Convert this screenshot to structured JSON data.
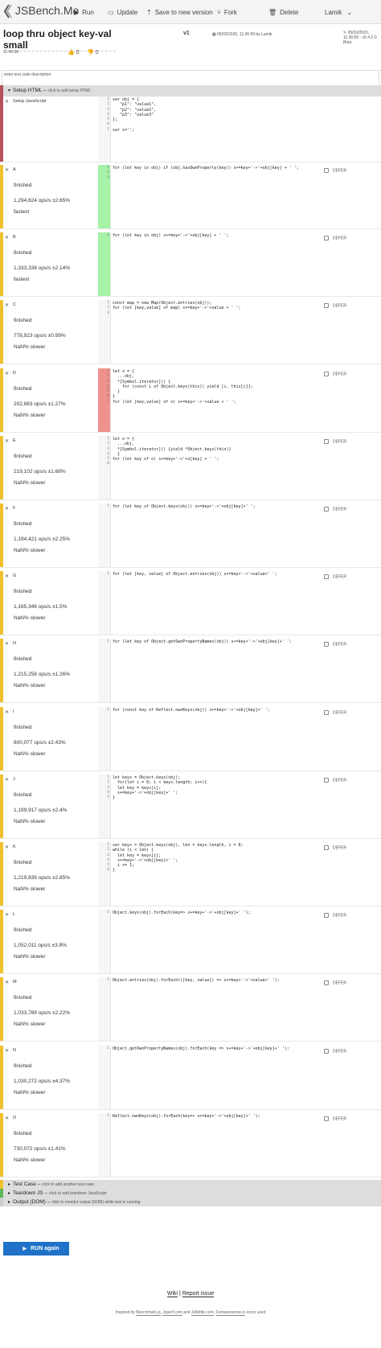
{
  "app": {
    "name": "JSBench.Me"
  },
  "toolbar": {
    "run": "Run",
    "update": "Update",
    "save_new": "Save to new version",
    "fork": "Fork",
    "delete": "Delete",
    "user": "Lamik"
  },
  "header": {
    "title": "loop thru object key-val small",
    "version": "v1",
    "updated": "05/03/2020, 11:36:59 by Lamik",
    "meta_right": "05/03/2020, 11:36:59 · v0.4.2-0 Beta",
    "created_time": "11:40:58",
    "likes": "0",
    "dislikes": "0"
  },
  "description": {
    "placeholder": "enter test suite description"
  },
  "setup_html": {
    "label": "Setup HTML",
    "hint": "click to add setup HTML"
  },
  "setup_js": {
    "label": "Setup JavaScript",
    "line_numbers": "1\n2\n3\n4\n5\n6\n7",
    "code": "var obj = {\n   \"p1\": \"value1\",\n   \"p2\": \"value2\",\n   \"p3\": \"value3\"\n};\n\nvar s='';"
  },
  "defer_label": "DEFER",
  "tests": [
    {
      "name": "A",
      "status": "finished",
      "ops": "1,294,624 ops/s ±2.65%",
      "result": "fastest",
      "gutter": "green",
      "lines": "1\n2\n3",
      "code": "for (let key in obj) if (obj.hasOwnProperty(key)) s+=key+'->'+obj[key] + ' ';"
    },
    {
      "name": "B",
      "status": "finished",
      "ops": "1,333,338 ops/s ±2.14%",
      "result": "fastest",
      "gutter": "green",
      "lines": "1",
      "code": "for (let key in obj) s+=key+'->'+obj[key] + ' ';"
    },
    {
      "name": "C",
      "status": "finished",
      "ops": "778,923 ops/s ±0.99%",
      "result": "NaN% slower",
      "gutter": "",
      "lines": "1\n2\n3",
      "code": "const map = new Map(Object.entries(obj));\nfor (let [key,value] of map) s+=key+'->'+value + ' ';"
    },
    {
      "name": "D",
      "status": "finished",
      "ops": "202,883 ops/s ±1.27%",
      "result": "NaN% slower",
      "gutter": "red",
      "lines": "1\n2\n3\n4\n5\n6\n7",
      "code": "let o = {\n  ...obj,\n  *[Symbol.iterator]() {\n    for (const i of Object.keys(this)) yield [i, this[i]];\n  }\n}\nfor (let [key,value] of o) s+=key+'->'+value + ' ';"
    },
    {
      "name": "E",
      "status": "finished",
      "ops": "219,102 ops/s ±1.68%",
      "result": "NaN% slower",
      "gutter": "",
      "lines": "1\n2\n3\n4\n5\n6",
      "code": "let o = {\n  ...obj,\n  *[Symbol.iterator]() {yield *Object.keys(this)}\n  }\nfor (let key of o) s+=key+'->'+o[key] + ' ';"
    },
    {
      "name": "F",
      "status": "finished",
      "ops": "1,194,421 ops/s ±2.25%",
      "result": "NaN% slower",
      "gutter": "",
      "lines": "1",
      "code": "for (let key of Object.keys(obj)) s+=key+'->'+obj[key]+' ';"
    },
    {
      "name": "G",
      "status": "finished",
      "ops": "1,165,346 ops/s ±1.5%",
      "result": "NaN% slower",
      "gutter": "",
      "lines": "1",
      "code": "for (let [key, value] of Object.entries(obj)) s+=key+'->'+value+' ';"
    },
    {
      "name": "H",
      "status": "finished",
      "ops": "1,215,258 ops/s ±1.26%",
      "result": "NaN% slower",
      "gutter": "",
      "lines": "1",
      "code": "for (let key of Object.getOwnPropertyNames(obj)) s+=key+'->'+obj[key]+' ';"
    },
    {
      "name": "I",
      "status": "finished",
      "ops": "800,077 ops/s ±2.43%",
      "result": "NaN% slower",
      "gutter": "",
      "lines": "1",
      "code": "for (const key of Reflect.ownKeys(obj)) s+=key+'->'+obj[key]+' ';"
    },
    {
      "name": "J",
      "status": "finished",
      "ops": "1,199,917 ops/s ±2.4%",
      "result": "NaN% slower",
      "gutter": "",
      "lines": "1\n2\n3\n4\n5",
      "code": "let keys = Object.keys(obj);\n  for(let i = 0; i < keys.length; i++){\n  let key = keys[i];\n  s+=key+'->'+obj[key]+' ';\n}"
    },
    {
      "name": "K",
      "status": "finished",
      "ops": "1,219,839 ops/s ±2.85%",
      "result": "NaN% slower",
      "gutter": "",
      "lines": "1\n2\n3\n4\n5\n6",
      "code": "var keys = Object.keys(obj), len = keys.length, i = 0;\nwhile (i < len) {\n  let key = keys[i];\n  s+=key+'->'+obj[key]+' ';\n  i += 1;\n}"
    },
    {
      "name": "L",
      "status": "finished",
      "ops": "1,052,011 ops/s ±3.8%",
      "result": "NaN% slower",
      "gutter": "",
      "lines": "1",
      "code": "Object.keys(obj).forEach(key=> s+=key+'->'+obj[key]+' ');"
    },
    {
      "name": "M",
      "status": "finished",
      "ops": "1,033,789 ops/s ±2.22%",
      "result": "NaN% slower",
      "gutter": "",
      "lines": "1",
      "code": "Object.entries(obj).forEach(([key, value]) => s+=key+'->'+value+' ');"
    },
    {
      "name": "N",
      "status": "finished",
      "ops": "1,030,272 ops/s ±4.37%",
      "result": "NaN% slower",
      "gutter": "",
      "lines": "1",
      "code": "Object.getOwnPropertyNames(obj).forEach(key => s+=key+'->'+obj[key]+' ');"
    },
    {
      "name": "O",
      "status": "finished",
      "ops": "730,072 ops/s ±1.41%",
      "result": "NaN% slower",
      "gutter": "",
      "lines": "1",
      "code": "Reflect.ownKeys(obj).forEach(key=> s+=key+'->'+obj[key]+' ');"
    }
  ],
  "bottom_sections": [
    {
      "label": "Test Case",
      "hint": "click to add another test case",
      "color": "#f0c02e"
    },
    {
      "label": "Teardown JS",
      "hint": "click to add teardown JavaScript",
      "color": "#5cb85c"
    },
    {
      "label": "Output (DOM)",
      "hint": "click to monitor output (DOM) while test is running",
      "color": "#cccccc"
    }
  ],
  "run_again": "RUN again",
  "footer": {
    "wiki": "Wiki",
    "sep": "|",
    "report": "Report issue",
    "credit_prefix": "Inspired by",
    "credit_1": "Benchmark.js",
    "credit_2": "Jsperf.com",
    "credit_and": "and",
    "credit_3": "Jsfiddle.com",
    "credit_4": "Fontawesome.io",
    "credit_suffix": "icons used"
  }
}
